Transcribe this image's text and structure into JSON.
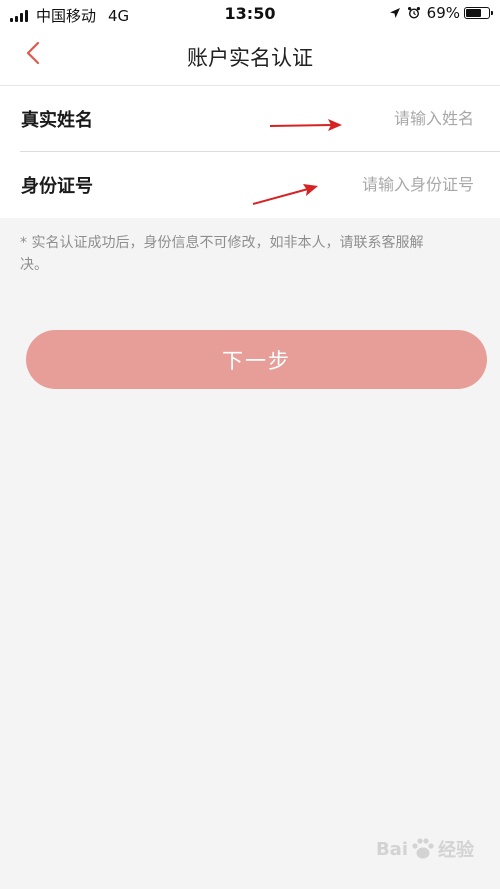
{
  "status_bar": {
    "carrier": "中国移动",
    "network": "4G",
    "time": "13:50",
    "battery": "69%",
    "battery_level": 0.69
  },
  "nav": {
    "title": "账户实名认证"
  },
  "form": {
    "name_label": "真实姓名",
    "name_placeholder": "请输入姓名",
    "id_label": "身份证号",
    "id_placeholder": "请输入身份证号"
  },
  "notice": "* 实名认证成功后，身份信息不可修改，如非本人，请联系客服解决。",
  "next_button_label": "下一步",
  "watermark": {
    "text_a": "Bai",
    "text_b": "经验"
  },
  "colors": {
    "accent": "#e89e98",
    "back_arrow": "#e2584d",
    "annotation_arrow": "#d62222"
  }
}
